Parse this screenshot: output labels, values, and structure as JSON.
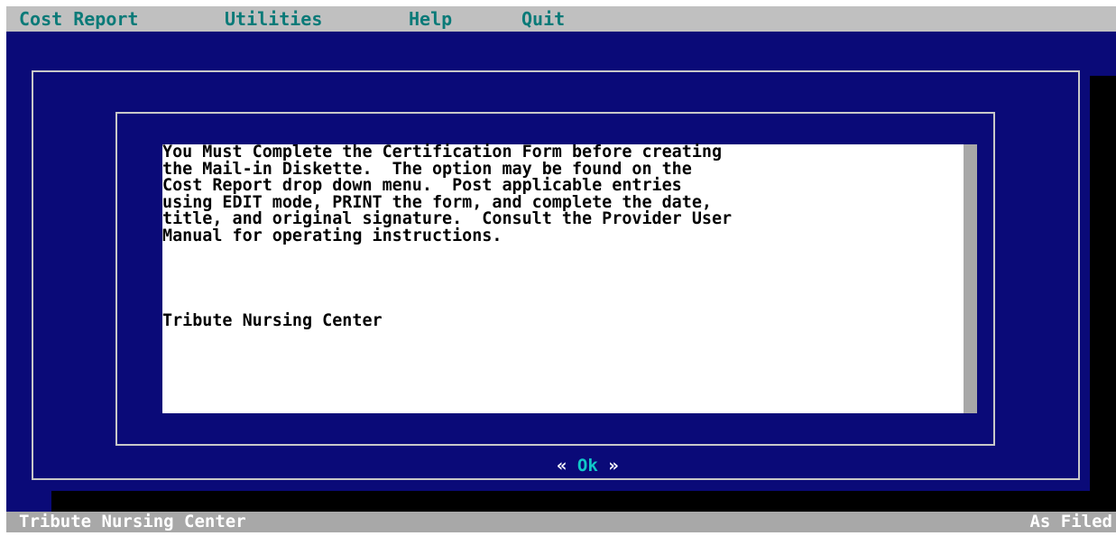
{
  "menubar": {
    "items": [
      {
        "label": "Cost Report"
      },
      {
        "label": "Utilities"
      },
      {
        "label": "Help"
      },
      {
        "label": "Quit"
      }
    ]
  },
  "dialog": {
    "message_lines": [
      "You Must Complete the Certification Form before creating",
      "the Mail-in Diskette.  The option may be found on the",
      "Cost Report drop down menu.  Post applicable entries",
      "using EDIT mode, PRINT the form, and complete the date,",
      "title, and original signature.  Consult the Provider User",
      "Manual for operating instructions."
    ],
    "facility_name": "Tribute Nursing Center",
    "ok_left": "« ",
    "ok_label": "Ok",
    "ok_right": " »"
  },
  "statusbar": {
    "facility": "Tribute Nursing Center",
    "filing_status": "As Filed"
  },
  "colors": {
    "background": "#0a0a78",
    "menubar": "#c0c0c0",
    "menu_text": "#0a7a78",
    "highlight": "#10c8c8",
    "statusbar": "#a8a8a8"
  }
}
